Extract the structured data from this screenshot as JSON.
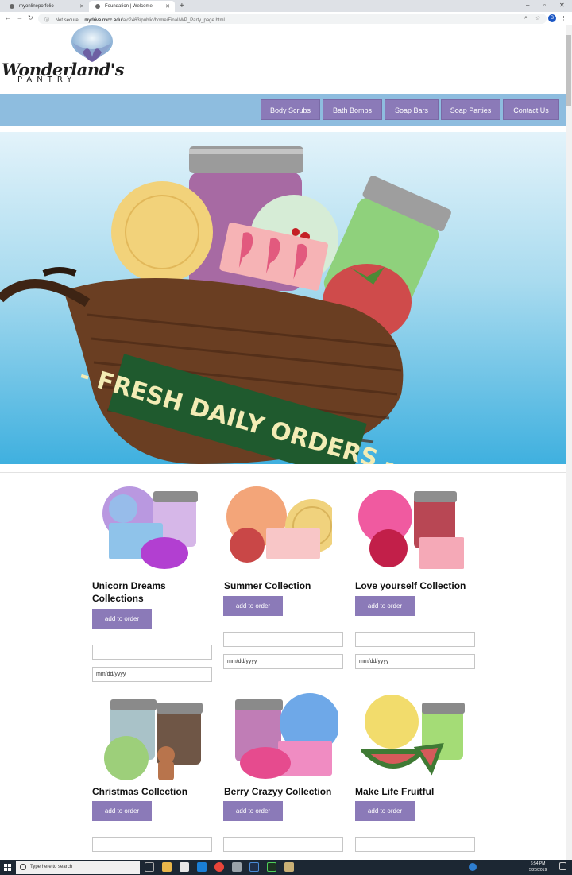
{
  "browser": {
    "tabs": [
      {
        "title": "myonlineporfolio",
        "active": false
      },
      {
        "title": "Foundation | Welcome",
        "active": true
      }
    ],
    "security": "Not secure",
    "url_domain": "mydrive.nvcc.edu",
    "url_path": "/ajc2463/public/home/Final/WP_Party_page.html",
    "profile_initial": "B"
  },
  "site": {
    "logo_script": "Wonderland's",
    "logo_sub": "PANTRY",
    "nav": [
      "Body Scrubs",
      "Bath Bombs",
      "Soap Bars",
      "Soap Parties",
      "Contact Us"
    ],
    "hero_banner": "- FRESH DAILY ORDERS -"
  },
  "products": [
    {
      "title": "Unicorn Dreams Collections",
      "button": "add to order",
      "date_placeholder": "mm/dd/yyyy"
    },
    {
      "title": "Summer Collection",
      "button": "add to order",
      "date_placeholder": "mm/dd/yyyy"
    },
    {
      "title": "Love yourself Collection",
      "button": "add to order",
      "date_placeholder": "mm/dd/yyyy"
    },
    {
      "title": "Christmas Collection",
      "button": "add to order"
    },
    {
      "title": "Berry Crazyy Collection",
      "button": "add to order"
    },
    {
      "title": "Make Life Fruitful",
      "button": "add to order"
    }
  ],
  "taskbar": {
    "search_placeholder": "Type here to search",
    "time": "6:54 PM",
    "date": "5/20/2019"
  },
  "colors": {
    "nav_strip": "#8ebddf",
    "button_purple": "#8b7ab8",
    "hero_sky": "#3fb0df"
  }
}
